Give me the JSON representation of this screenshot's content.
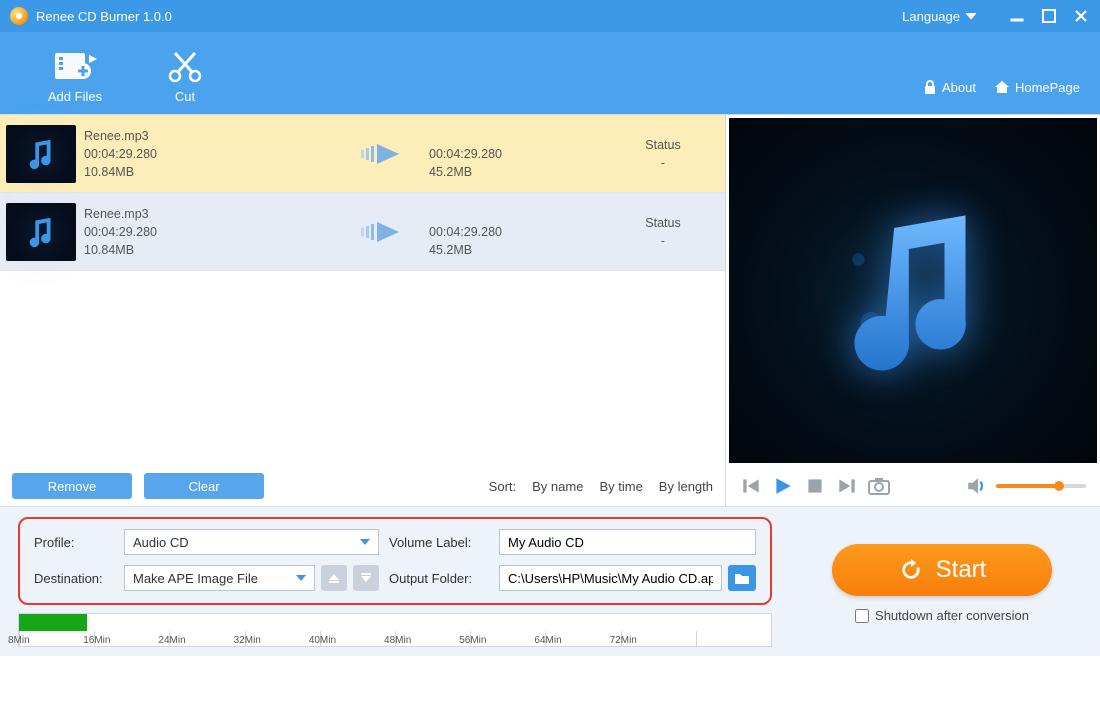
{
  "titlebar": {
    "title": "Renee CD Burner 1.0.0",
    "language": "Language"
  },
  "toolbar": {
    "add_files": "Add Files",
    "cut": "Cut",
    "about": "About",
    "homepage": "HomePage"
  },
  "files": [
    {
      "name": "Renee.mp3",
      "duration": "00:04:29.280",
      "size": "10.84MB",
      "out_duration": "00:04:29.280",
      "out_size": "45.2MB",
      "status_label": "Status",
      "status_value": "-"
    },
    {
      "name": "Renee.mp3",
      "duration": "00:04:29.280",
      "size": "10.84MB",
      "out_duration": "00:04:29.280",
      "out_size": "45.2MB",
      "status_label": "Status",
      "status_value": "-"
    }
  ],
  "listbar": {
    "remove": "Remove",
    "clear": "Clear",
    "sort_label": "Sort:",
    "by_name": "By name",
    "by_time": "By time",
    "by_length": "By length"
  },
  "settings": {
    "profile_label": "Profile:",
    "profile_value": "Audio CD",
    "destination_label": "Destination:",
    "destination_value": "Make APE Image File",
    "volume_label": "Volume Label:",
    "volume_value": "My Audio CD",
    "output_label": "Output Folder:",
    "output_value": "C:\\Users\\HP\\Music\\My Audio CD.ape"
  },
  "timeline_ticks": [
    "8Min",
    "16Min",
    "24Min",
    "32Min",
    "40Min",
    "48Min",
    "56Min",
    "64Min",
    "72Min"
  ],
  "actions": {
    "start": "Start",
    "shutdown": "Shutdown after conversion"
  }
}
